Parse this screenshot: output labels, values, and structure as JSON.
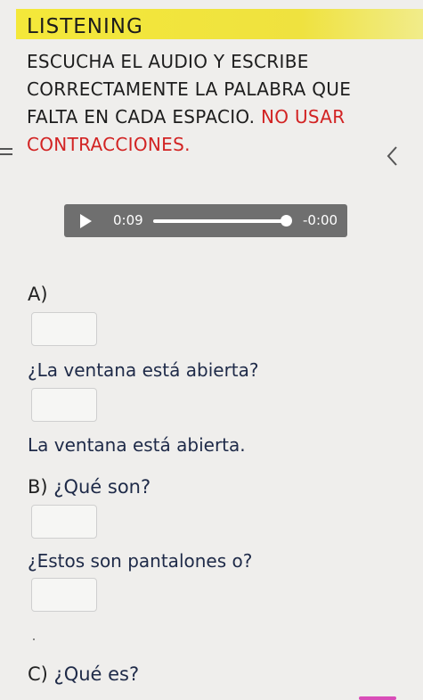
{
  "header": {
    "title": "LISTENING"
  },
  "instruction": {
    "text": "ESCUCHA EL AUDIO Y ESCRIBE CORRECTAMENTE LA PALABRA QUE FALTA EN CADA ESPACIO. ",
    "warning": "NO USAR CONTRACCIONES."
  },
  "audio": {
    "current_time": "0:09",
    "remaining_time": "-0:00",
    "progress": 1.0
  },
  "sections": [
    {
      "label": "A)",
      "prompt": "",
      "question": "¿La ventana está abierta?",
      "answer": "La ventana está abierta."
    },
    {
      "label": "B)",
      "prompt": "¿Qué son?",
      "question": "¿Estos son pantalones o?"
    },
    {
      "label": "C)",
      "prompt": "¿Qué es?"
    }
  ],
  "colors": {
    "header_bg": "#f0e33a",
    "warning": "#d22323",
    "question_text": "#1e2a48",
    "player_bg": "#6f6f6f",
    "accent_marker": "#d94db8"
  },
  "icons": {
    "menu": "menu-icon",
    "back": "chevron-left-icon",
    "play": "play-icon"
  }
}
